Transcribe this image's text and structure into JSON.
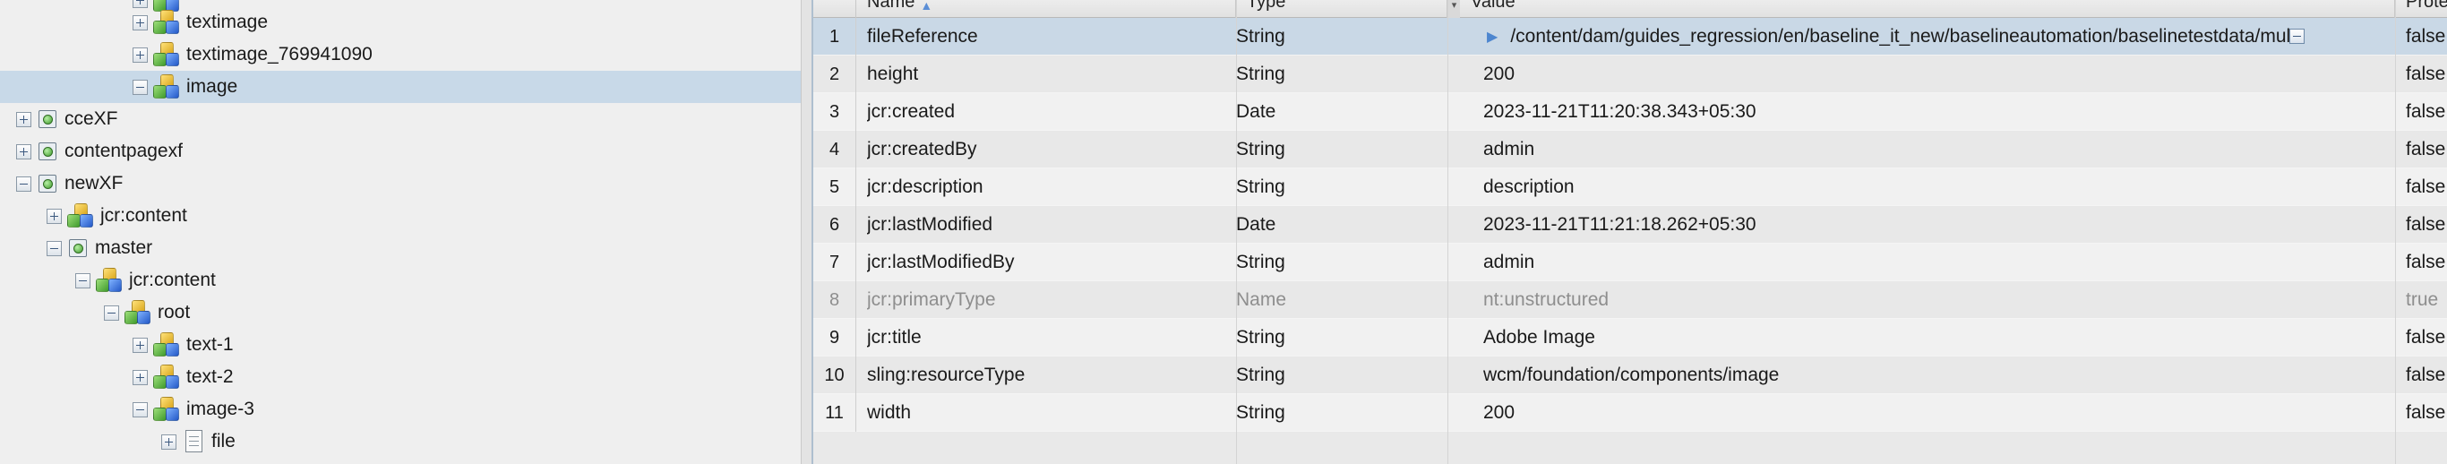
{
  "tree": {
    "nodes": [
      {
        "label": "textimage",
        "icon": "node-cubes-icon",
        "expander": "plus"
      },
      {
        "label": "textimage_769941090",
        "icon": "node-cubes-icon",
        "expander": "plus"
      },
      {
        "label": "image",
        "icon": "node-cubes-icon",
        "expander": "minus",
        "selected": true
      },
      {
        "label": "cceXF",
        "icon": "experience-fragment-icon",
        "expander": "plus"
      },
      {
        "label": "contentpagexf",
        "icon": "experience-fragment-icon",
        "expander": "plus"
      },
      {
        "label": "newXF",
        "icon": "experience-fragment-icon",
        "expander": "minus"
      },
      {
        "label": "jcr:content",
        "icon": "node-cubes-icon",
        "expander": "plus"
      },
      {
        "label": "master",
        "icon": "experience-fragment-icon",
        "expander": "minus"
      },
      {
        "label": "jcr:content",
        "icon": "node-cubes-icon",
        "expander": "minus"
      },
      {
        "label": "root",
        "icon": "node-cubes-icon",
        "expander": "minus"
      },
      {
        "label": "text-1",
        "icon": "node-cubes-icon",
        "expander": "plus"
      },
      {
        "label": "text-2",
        "icon": "node-cubes-icon",
        "expander": "plus"
      },
      {
        "label": "image-3",
        "icon": "node-cubes-icon",
        "expander": "minus"
      },
      {
        "label": "file",
        "icon": "file-icon",
        "expander": "plus"
      }
    ]
  },
  "grid": {
    "columns": {
      "name": "Name",
      "type": "Type",
      "value": "Value",
      "protected": "Prote"
    },
    "sort_icon": "sort-ascending-icon",
    "rows": [
      {
        "num": "1",
        "name": "fileReference",
        "type": "String",
        "value": "/content/dam/guides_regression/en/baseline_it_new/baselineautomation/baselinetestdata/multimed",
        "protected": "false",
        "multi": true
      },
      {
        "num": "2",
        "name": "height",
        "type": "String",
        "value": "200",
        "protected": "false"
      },
      {
        "num": "3",
        "name": "jcr:created",
        "type": "Date",
        "value": "2023-11-21T11:20:38.343+05:30",
        "protected": "false"
      },
      {
        "num": "4",
        "name": "jcr:createdBy",
        "type": "String",
        "value": "admin",
        "protected": "false"
      },
      {
        "num": "5",
        "name": "jcr:description",
        "type": "String",
        "value": "description",
        "protected": "false"
      },
      {
        "num": "6",
        "name": "jcr:lastModified",
        "type": "Date",
        "value": "2023-11-21T11:21:18.262+05:30",
        "protected": "false"
      },
      {
        "num": "7",
        "name": "jcr:lastModifiedBy",
        "type": "String",
        "value": "admin",
        "protected": "false"
      },
      {
        "num": "8",
        "name": "jcr:primaryType",
        "type": "Name",
        "value": "nt:unstructured",
        "protected": "true"
      },
      {
        "num": "9",
        "name": "jcr:title",
        "type": "String",
        "value": "Adobe Image",
        "protected": "false"
      },
      {
        "num": "10",
        "name": "sling:resourceType",
        "type": "String",
        "value": "wcm/foundation/components/image",
        "protected": "false"
      },
      {
        "num": "11",
        "name": "width",
        "type": "String",
        "value": "200",
        "protected": "false"
      }
    ]
  }
}
